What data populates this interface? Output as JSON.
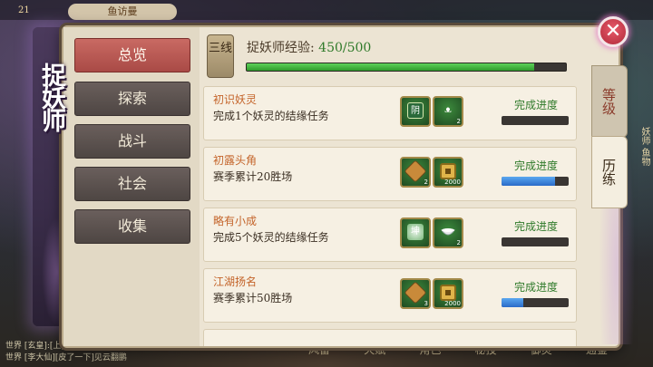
{
  "background": {
    "level": "21",
    "top_pill": "鱼访曼",
    "chat_line_1": "世界 [玄皇]:[上]志皇总云延翔",
    "chat_line_2": "世界 [李大仙][皮了一下]见云翻鹏",
    "bottom_icons": [
      "风雷",
      "天赋",
      "角色",
      "秘技",
      "御灵",
      "通鉴"
    ],
    "right_side_text": "妖师 鱼物"
  },
  "banner": {
    "title": "捉妖师"
  },
  "sidebar": {
    "items": [
      {
        "label": "总览",
        "active": true
      },
      {
        "label": "探索",
        "active": false
      },
      {
        "label": "战斗",
        "active": false
      },
      {
        "label": "社会",
        "active": false
      },
      {
        "label": "收集",
        "active": false
      }
    ]
  },
  "header": {
    "rank_badge": "三线",
    "exp_label": "捉妖师经验:",
    "exp_value": "450/500",
    "exp_progress": 0.9
  },
  "side_tabs": [
    {
      "label": "等级",
      "active": false
    },
    {
      "label": "历练",
      "active": true
    }
  ],
  "tasks": [
    {
      "title": "初识妖灵",
      "desc": "完成1个妖灵的结缘任务",
      "rewards": [
        {
          "icon": "certificate-icon",
          "glyph": "阴",
          "count": ""
        },
        {
          "icon": "spirit-icon",
          "glyph": "ᴥ",
          "count": "2"
        }
      ],
      "progress_label": "完成进度",
      "progress": 0
    },
    {
      "title": "初露头角",
      "desc": "赛季累计20胜场",
      "rewards": [
        {
          "icon": "rune-icon",
          "glyph": "",
          "count": "2"
        },
        {
          "icon": "coin-icon",
          "glyph": "",
          "count": "2000"
        }
      ],
      "progress_label": "完成进度",
      "progress": 0.8
    },
    {
      "title": "略有小成",
      "desc": "完成5个妖灵的结缘任务",
      "rewards": [
        {
          "icon": "orb-icon",
          "glyph": "坤",
          "count": ""
        },
        {
          "icon": "bowl-icon",
          "glyph": "",
          "count": "2"
        }
      ],
      "progress_label": "完成进度",
      "progress": 0
    },
    {
      "title": "江湖扬名",
      "desc": "赛季累计50胜场",
      "rewards": [
        {
          "icon": "rune-icon",
          "glyph": "",
          "count": "3"
        },
        {
          "icon": "coin-icon",
          "glyph": "",
          "count": "2000"
        }
      ],
      "progress_label": "完成进度",
      "progress": 0.32
    }
  ],
  "close": {
    "label": "✕"
  }
}
